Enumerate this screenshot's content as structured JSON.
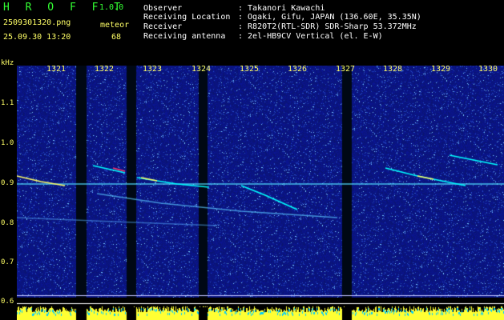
{
  "app": {
    "title": "H R O F F T",
    "version": "1.0.0"
  },
  "capture": {
    "filename": "2509301320.png",
    "meteor_label": "meteor",
    "datetime": "25.09.30 13:20",
    "meteor_count": "68"
  },
  "station": {
    "observer_key": "Observer",
    "observer_val": ": Takanori Kawachi",
    "location_key": "Receiving Location",
    "location_val": ": Ogaki, Gifu, JAPAN (136.60E, 35.35N)",
    "receiver_key": "Receiver",
    "receiver_val": ": R820T2(RTL-SDR) SDR-Sharp 53.372MHz",
    "antenna_key": "Receiving antenna",
    "antenna_val": ": 2el-HB9CV Vertical (el. E-W)"
  },
  "axis": {
    "unit": "kHz",
    "y_ticks": [
      "1.1",
      "1.0",
      "0.9",
      "0.8",
      "0.7",
      "0.6"
    ],
    "x_ticks": [
      "1321",
      "1322",
      "1323",
      "1324",
      "1325",
      "1326",
      "1327",
      "1328",
      "1329",
      "1330"
    ]
  },
  "colors": {
    "background": "#000000",
    "spectrogram_base": "#0a1a7a",
    "label_green": "#33ff33",
    "label_yellow": "#ffff66",
    "trace": "#00ffff",
    "dropout": "#000814"
  }
}
